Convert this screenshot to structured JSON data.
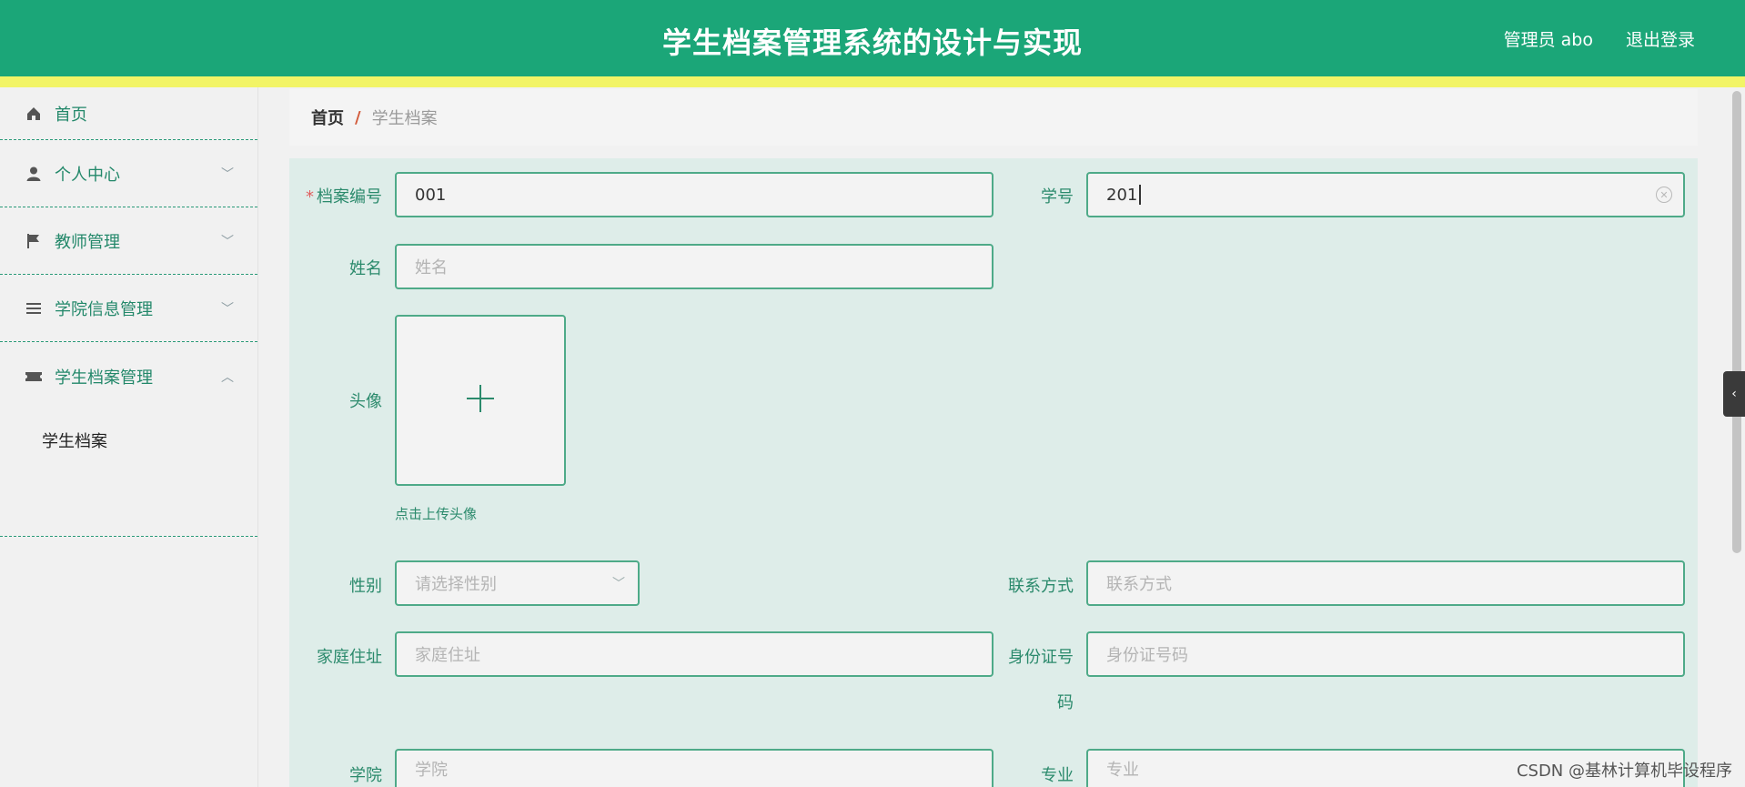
{
  "header": {
    "title": "学生档案管理系统的设计与实现",
    "user_label": "管理员 abo",
    "logout_label": "退出登录"
  },
  "sidebar": {
    "items": [
      {
        "label": "首页",
        "icon": "home-icon"
      },
      {
        "label": "个人中心",
        "icon": "user-icon"
      },
      {
        "label": "教师管理",
        "icon": "flag-icon"
      },
      {
        "label": "学院信息管理",
        "icon": "list-icon"
      },
      {
        "label": "学生档案管理",
        "icon": "ticket-icon"
      }
    ],
    "submenu": [
      {
        "label": "学生档案"
      }
    ]
  },
  "breadcrumb": {
    "home": "首页",
    "separator": "/",
    "current": "学生档案"
  },
  "form": {
    "archive_no": {
      "label": "档案编号",
      "required_mark": "*",
      "value": "001"
    },
    "student_no": {
      "label": "学号",
      "value": "201"
    },
    "name": {
      "label": "姓名",
      "placeholder": "姓名"
    },
    "avatar": {
      "label": "头像",
      "hint": "点击上传头像"
    },
    "gender": {
      "label": "性别",
      "placeholder": "请选择性别"
    },
    "contact": {
      "label": "联系方式",
      "placeholder": "联系方式"
    },
    "address": {
      "label": "家庭住址",
      "placeholder": "家庭住址"
    },
    "id_card": {
      "label_line1": "身份证号",
      "label_line2": "码",
      "placeholder": "身份证号码"
    },
    "college": {
      "label": "学院",
      "placeholder": "学院"
    },
    "major": {
      "label": "专业",
      "placeholder": "专业"
    }
  },
  "watermark": "CSDN @基林计算机毕设程序",
  "colors": {
    "header_bg": "#1ba678",
    "stripe": "#f2f466",
    "form_bg": "#deede9",
    "accent": "#4eaa88"
  }
}
